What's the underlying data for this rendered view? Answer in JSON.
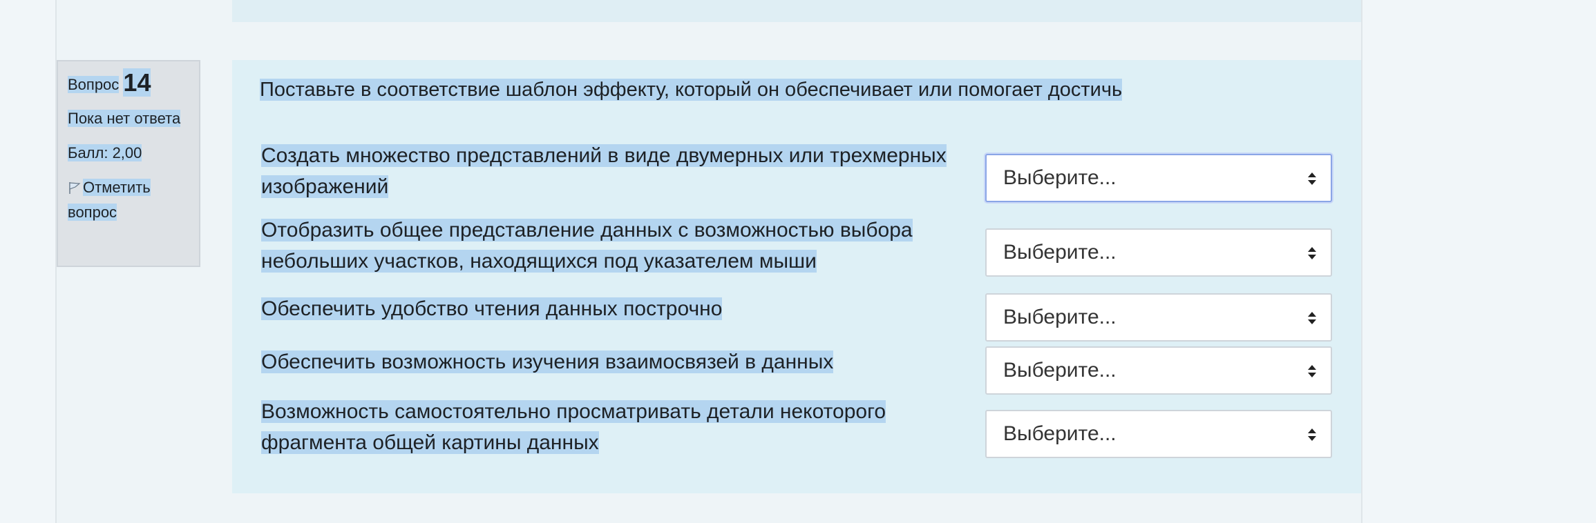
{
  "question": {
    "label": "Вопрос",
    "number": "14",
    "status": "Пока нет ответа",
    "score": "Балл: 2,00",
    "flag_label": "Отметить вопрос",
    "text": "Поставьте в соответствие шаблон эффекту, который он обеспечивает или помогает достичь"
  },
  "items": [
    {
      "line1": "Создать множество представлений в виде двумерных или трехмерных",
      "line2": "изображений",
      "select": "Выберите..."
    },
    {
      "line1": "Отобразить общее представление данных с возможностью выбора",
      "line2": "небольших участков, находящихся под указателем мыши",
      "select": "Выберите..."
    },
    {
      "line1": "Обеспечить удобство чтения данных построчно",
      "line2": "",
      "select": "Выберите..."
    },
    {
      "line1": "Обеспечить возможность изучения взаимосвязей в данных",
      "line2": "",
      "select": "Выберите..."
    },
    {
      "line1": "Возможность самостоятельно просматривать детали некоторого",
      "line2": "фрагмента общей картины данных",
      "select": "Выберите..."
    }
  ],
  "colors": {
    "selection_highlight": "#b4d5f0",
    "content_bg": "#def0f6",
    "focus_border": "#8aa5e6"
  }
}
